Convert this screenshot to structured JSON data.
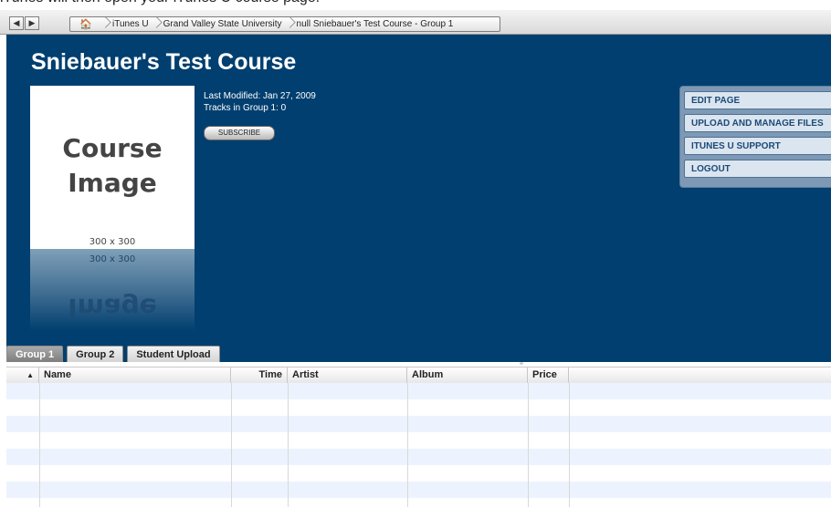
{
  "caption": "iTunes will then open your iTunes U course page.",
  "nav": {
    "back_glyph": "◀",
    "forward_glyph": "▶",
    "home_glyph": "🏠",
    "breadcrumbs": [
      "iTunes U",
      "Grand Valley State University",
      "null Sniebauer's Test Course - Group 1"
    ]
  },
  "course": {
    "title": "Sniebauer's Test Course",
    "art_line1": "Course",
    "art_line2": "Image",
    "art_size": "300 x 300",
    "reflection_word": "Image",
    "last_modified": "Last Modified: Jan 27, 2009",
    "tracks": "Tracks in Group 1: 0",
    "subscribe_label": "SUBSCRIBE"
  },
  "menu": {
    "items": [
      {
        "label": "EDIT PAGE"
      },
      {
        "label": "UPLOAD AND MANAGE FILES"
      },
      {
        "label": "ITUNES U SUPPORT"
      },
      {
        "label": "LOGOUT"
      }
    ]
  },
  "tabs": [
    {
      "label": "Group 1",
      "active": true
    },
    {
      "label": "Group 2",
      "active": false
    },
    {
      "label": "Student Upload",
      "active": false
    }
  ],
  "table": {
    "sort_glyph": "▲",
    "columns": [
      "Name",
      "Time",
      "Artist",
      "Album",
      "Price"
    ]
  },
  "colors": {
    "page_bg": "#003f6f",
    "menu_text": "#1b4a78",
    "row_alt": "#edf3fe"
  }
}
